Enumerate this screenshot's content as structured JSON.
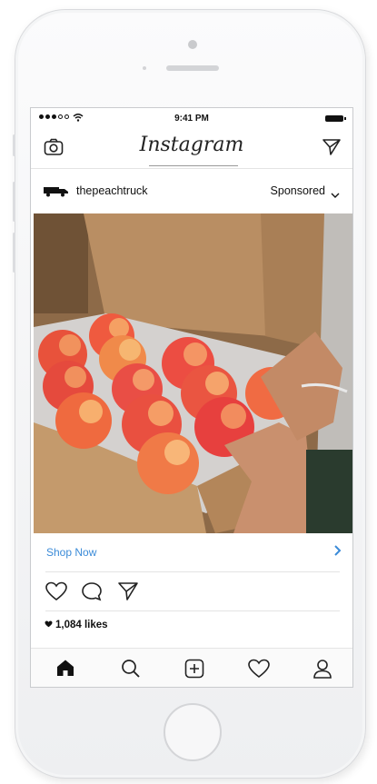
{
  "status_bar": {
    "time": "9:41 PM",
    "signal": "●●●○○",
    "wifi_icon": "wifi-icon",
    "battery_icon": "battery-icon"
  },
  "header": {
    "logo": "Instagram",
    "left_icon": "camera-icon",
    "right_icon": "direct-send-icon"
  },
  "post": {
    "username": "thepeachtruck",
    "avatar_icon": "truck-logo-icon",
    "sponsored_label": "Sponsored",
    "options_icon": "chevron-down-icon",
    "image_alt": "Peaches in a cardboard box",
    "cta_label": "Shop Now",
    "cta_icon": "chevron-right-icon",
    "actions": [
      "heart-icon",
      "comment-icon",
      "share-icon"
    ],
    "likes": "1,084 likes"
  },
  "tab_bar": {
    "items": [
      "home-icon",
      "search-icon",
      "add-post-icon",
      "activity-heart-icon",
      "profile-icon"
    ]
  },
  "colors": {
    "cta_link": "#3b8bd8",
    "text": "#111111",
    "divider": "#e4e4e4",
    "device_frame": "#f4f5f6"
  }
}
